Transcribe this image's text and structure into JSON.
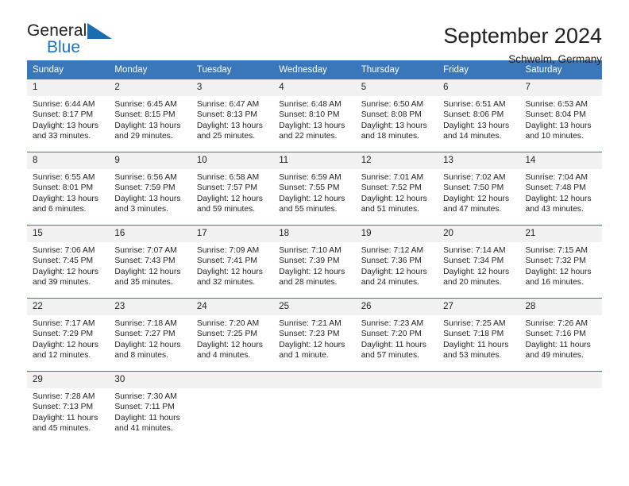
{
  "brand": {
    "name_top": "General",
    "name_bottom": "Blue",
    "triangle_color": "#1c6cb0",
    "accent_color": "#1c75bc"
  },
  "header": {
    "title": "September 2024",
    "subtitle": "Schwelm, Germany"
  },
  "theme": {
    "header_bg": "#3a77ba",
    "header_text": "#ffffff",
    "day_number_bg": "#f1f1f1",
    "cell_bg": "#ffffff",
    "text": "#231f20"
  },
  "calendar": {
    "weekdays": [
      "Sunday",
      "Monday",
      "Tuesday",
      "Wednesday",
      "Thursday",
      "Friday",
      "Saturday"
    ],
    "weeks": [
      [
        {
          "day": "1",
          "sunrise": "Sunrise: 6:44 AM",
          "sunset": "Sunset: 8:17 PM",
          "daylight_1": "Daylight: 13 hours",
          "daylight_2": "and 33 minutes."
        },
        {
          "day": "2",
          "sunrise": "Sunrise: 6:45 AM",
          "sunset": "Sunset: 8:15 PM",
          "daylight_1": "Daylight: 13 hours",
          "daylight_2": "and 29 minutes."
        },
        {
          "day": "3",
          "sunrise": "Sunrise: 6:47 AM",
          "sunset": "Sunset: 8:13 PM",
          "daylight_1": "Daylight: 13 hours",
          "daylight_2": "and 25 minutes."
        },
        {
          "day": "4",
          "sunrise": "Sunrise: 6:48 AM",
          "sunset": "Sunset: 8:10 PM",
          "daylight_1": "Daylight: 13 hours",
          "daylight_2": "and 22 minutes."
        },
        {
          "day": "5",
          "sunrise": "Sunrise: 6:50 AM",
          "sunset": "Sunset: 8:08 PM",
          "daylight_1": "Daylight: 13 hours",
          "daylight_2": "and 18 minutes."
        },
        {
          "day": "6",
          "sunrise": "Sunrise: 6:51 AM",
          "sunset": "Sunset: 8:06 PM",
          "daylight_1": "Daylight: 13 hours",
          "daylight_2": "and 14 minutes."
        },
        {
          "day": "7",
          "sunrise": "Sunrise: 6:53 AM",
          "sunset": "Sunset: 8:04 PM",
          "daylight_1": "Daylight: 13 hours",
          "daylight_2": "and 10 minutes."
        }
      ],
      [
        {
          "day": "8",
          "sunrise": "Sunrise: 6:55 AM",
          "sunset": "Sunset: 8:01 PM",
          "daylight_1": "Daylight: 13 hours",
          "daylight_2": "and 6 minutes."
        },
        {
          "day": "9",
          "sunrise": "Sunrise: 6:56 AM",
          "sunset": "Sunset: 7:59 PM",
          "daylight_1": "Daylight: 13 hours",
          "daylight_2": "and 3 minutes."
        },
        {
          "day": "10",
          "sunrise": "Sunrise: 6:58 AM",
          "sunset": "Sunset: 7:57 PM",
          "daylight_1": "Daylight: 12 hours",
          "daylight_2": "and 59 minutes."
        },
        {
          "day": "11",
          "sunrise": "Sunrise: 6:59 AM",
          "sunset": "Sunset: 7:55 PM",
          "daylight_1": "Daylight: 12 hours",
          "daylight_2": "and 55 minutes."
        },
        {
          "day": "12",
          "sunrise": "Sunrise: 7:01 AM",
          "sunset": "Sunset: 7:52 PM",
          "daylight_1": "Daylight: 12 hours",
          "daylight_2": "and 51 minutes."
        },
        {
          "day": "13",
          "sunrise": "Sunrise: 7:02 AM",
          "sunset": "Sunset: 7:50 PM",
          "daylight_1": "Daylight: 12 hours",
          "daylight_2": "and 47 minutes."
        },
        {
          "day": "14",
          "sunrise": "Sunrise: 7:04 AM",
          "sunset": "Sunset: 7:48 PM",
          "daylight_1": "Daylight: 12 hours",
          "daylight_2": "and 43 minutes."
        }
      ],
      [
        {
          "day": "15",
          "sunrise": "Sunrise: 7:06 AM",
          "sunset": "Sunset: 7:45 PM",
          "daylight_1": "Daylight: 12 hours",
          "daylight_2": "and 39 minutes."
        },
        {
          "day": "16",
          "sunrise": "Sunrise: 7:07 AM",
          "sunset": "Sunset: 7:43 PM",
          "daylight_1": "Daylight: 12 hours",
          "daylight_2": "and 35 minutes."
        },
        {
          "day": "17",
          "sunrise": "Sunrise: 7:09 AM",
          "sunset": "Sunset: 7:41 PM",
          "daylight_1": "Daylight: 12 hours",
          "daylight_2": "and 32 minutes."
        },
        {
          "day": "18",
          "sunrise": "Sunrise: 7:10 AM",
          "sunset": "Sunset: 7:39 PM",
          "daylight_1": "Daylight: 12 hours",
          "daylight_2": "and 28 minutes."
        },
        {
          "day": "19",
          "sunrise": "Sunrise: 7:12 AM",
          "sunset": "Sunset: 7:36 PM",
          "daylight_1": "Daylight: 12 hours",
          "daylight_2": "and 24 minutes."
        },
        {
          "day": "20",
          "sunrise": "Sunrise: 7:14 AM",
          "sunset": "Sunset: 7:34 PM",
          "daylight_1": "Daylight: 12 hours",
          "daylight_2": "and 20 minutes."
        },
        {
          "day": "21",
          "sunrise": "Sunrise: 7:15 AM",
          "sunset": "Sunset: 7:32 PM",
          "daylight_1": "Daylight: 12 hours",
          "daylight_2": "and 16 minutes."
        }
      ],
      [
        {
          "day": "22",
          "sunrise": "Sunrise: 7:17 AM",
          "sunset": "Sunset: 7:29 PM",
          "daylight_1": "Daylight: 12 hours",
          "daylight_2": "and 12 minutes."
        },
        {
          "day": "23",
          "sunrise": "Sunrise: 7:18 AM",
          "sunset": "Sunset: 7:27 PM",
          "daylight_1": "Daylight: 12 hours",
          "daylight_2": "and 8 minutes."
        },
        {
          "day": "24",
          "sunrise": "Sunrise: 7:20 AM",
          "sunset": "Sunset: 7:25 PM",
          "daylight_1": "Daylight: 12 hours",
          "daylight_2": "and 4 minutes."
        },
        {
          "day": "25",
          "sunrise": "Sunrise: 7:21 AM",
          "sunset": "Sunset: 7:23 PM",
          "daylight_1": "Daylight: 12 hours",
          "daylight_2": "and 1 minute."
        },
        {
          "day": "26",
          "sunrise": "Sunrise: 7:23 AM",
          "sunset": "Sunset: 7:20 PM",
          "daylight_1": "Daylight: 11 hours",
          "daylight_2": "and 57 minutes."
        },
        {
          "day": "27",
          "sunrise": "Sunrise: 7:25 AM",
          "sunset": "Sunset: 7:18 PM",
          "daylight_1": "Daylight: 11 hours",
          "daylight_2": "and 53 minutes."
        },
        {
          "day": "28",
          "sunrise": "Sunrise: 7:26 AM",
          "sunset": "Sunset: 7:16 PM",
          "daylight_1": "Daylight: 11 hours",
          "daylight_2": "and 49 minutes."
        }
      ],
      [
        {
          "day": "29",
          "sunrise": "Sunrise: 7:28 AM",
          "sunset": "Sunset: 7:13 PM",
          "daylight_1": "Daylight: 11 hours",
          "daylight_2": "and 45 minutes."
        },
        {
          "day": "30",
          "sunrise": "Sunrise: 7:30 AM",
          "sunset": "Sunset: 7:11 PM",
          "daylight_1": "Daylight: 11 hours",
          "daylight_2": "and 41 minutes."
        },
        {
          "day": "",
          "sunrise": "",
          "sunset": "",
          "daylight_1": "",
          "daylight_2": ""
        },
        {
          "day": "",
          "sunrise": "",
          "sunset": "",
          "daylight_1": "",
          "daylight_2": ""
        },
        {
          "day": "",
          "sunrise": "",
          "sunset": "",
          "daylight_1": "",
          "daylight_2": ""
        },
        {
          "day": "",
          "sunrise": "",
          "sunset": "",
          "daylight_1": "",
          "daylight_2": ""
        },
        {
          "day": "",
          "sunrise": "",
          "sunset": "",
          "daylight_1": "",
          "daylight_2": ""
        }
      ]
    ]
  }
}
